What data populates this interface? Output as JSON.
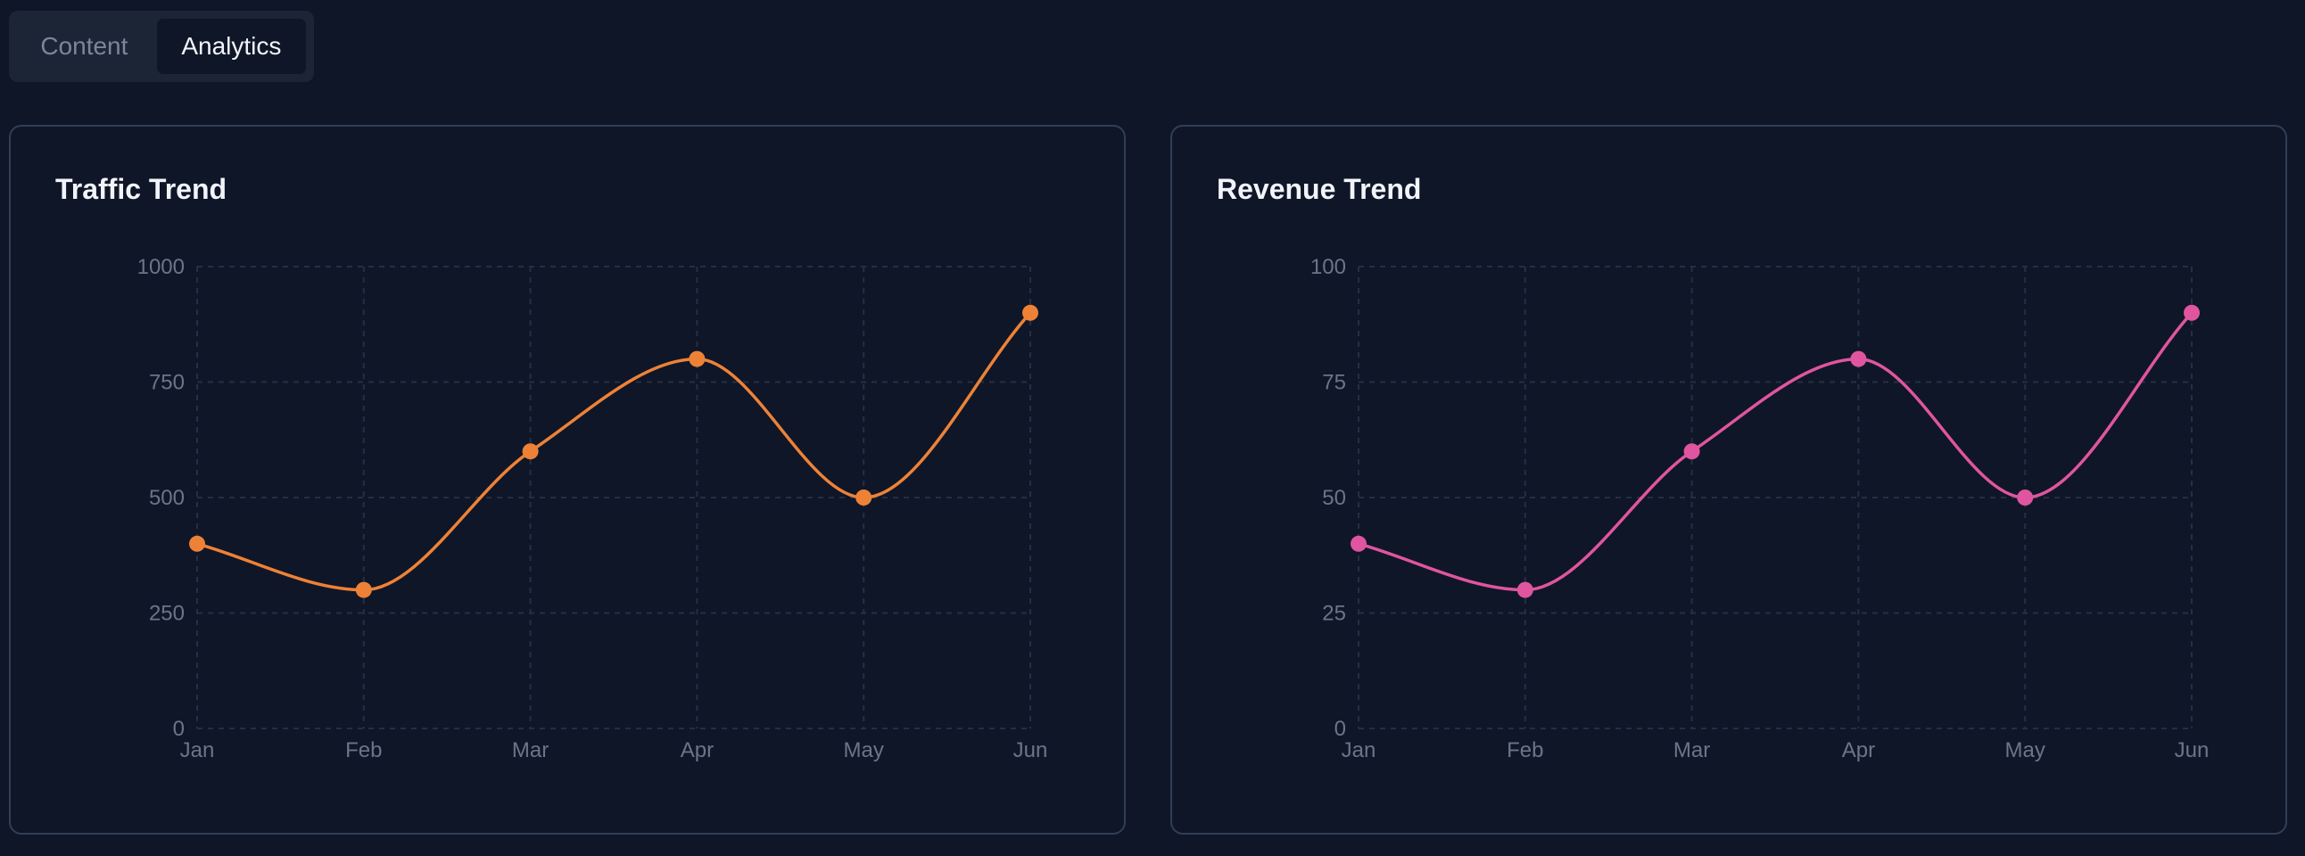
{
  "tabs": [
    {
      "label": "Content",
      "active": false
    },
    {
      "label": "Analytics",
      "active": true
    }
  ],
  "cards": [
    {
      "title": "Traffic Trend"
    },
    {
      "title": "Revenue Trend"
    }
  ],
  "chart_data": [
    {
      "type": "line",
      "title": "Traffic Trend",
      "categories": [
        "Jan",
        "Feb",
        "Mar",
        "Apr",
        "May",
        "Jun"
      ],
      "values": [
        400,
        300,
        600,
        800,
        500,
        900
      ],
      "ylim": [
        0,
        1000
      ],
      "yticks": [
        "0",
        "250",
        "500",
        "750",
        "1000"
      ],
      "color": "#ed8237",
      "grid": true
    },
    {
      "type": "line",
      "title": "Revenue Trend",
      "categories": [
        "Jan",
        "Feb",
        "Mar",
        "Apr",
        "May",
        "Jun"
      ],
      "values": [
        40,
        30,
        60,
        80,
        50,
        90
      ],
      "ylim": [
        0,
        100
      ],
      "yticks": [
        "0",
        "25",
        "50",
        "75",
        "100"
      ],
      "color": "#e0559f",
      "grid": true
    }
  ]
}
